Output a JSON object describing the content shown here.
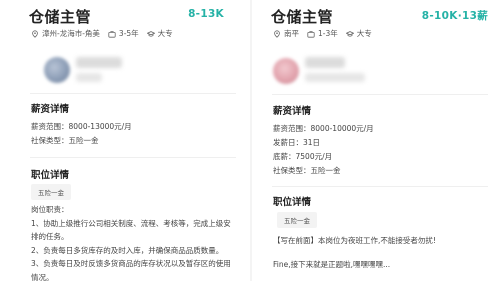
{
  "left": {
    "title": "仓储主管",
    "salary": "8-13K",
    "meta": {
      "location": "漳州-龙海市-角美",
      "experience": "3-5年",
      "education": "大专"
    },
    "salary_section": {
      "heading": "薪资详情",
      "range": "薪资范围：8000-13000元/月",
      "insurance": "社保类型：五险一金"
    },
    "job_section": {
      "heading": "职位详情",
      "tag": "五险一金",
      "desc_title": "岗位职责：",
      "desc_lines": [
        "1、协助上级推行公司相关制度、流程、考核等，完成上级安",
        "排的任务。",
        "2、负责每日多货库存的及时入库，并确保商品品质数量。",
        "3、负责每日及时反馈多货商品的库存状况以及暂存区的使用",
        "情况。"
      ]
    }
  },
  "right": {
    "title": "仓储主管",
    "salary": "8-10K·13薪",
    "meta": {
      "location": "南平",
      "experience": "1-3年",
      "education": "大专"
    },
    "salary_section": {
      "heading": "薪资详情",
      "range": "薪资范围：8000-10000元/月",
      "payday": "发薪日：31日",
      "base": "底薪：7500元/月",
      "insurance": "社保类型：五险一金"
    },
    "job_section": {
      "heading": "职位详情",
      "tag": "五险一金",
      "line1": "【写在前面】本岗位为夜班工作,不能接受者勿扰!",
      "line2": "Fine,接下来就是正题啦,嘿嘿嘿嘿..."
    }
  },
  "colors": {
    "accent": "#25b2a6",
    "text": "#222222",
    "muted": "#555555"
  },
  "icons": {
    "location": "location-pin-icon",
    "experience": "briefcase-icon",
    "education": "graduation-cap-icon"
  }
}
